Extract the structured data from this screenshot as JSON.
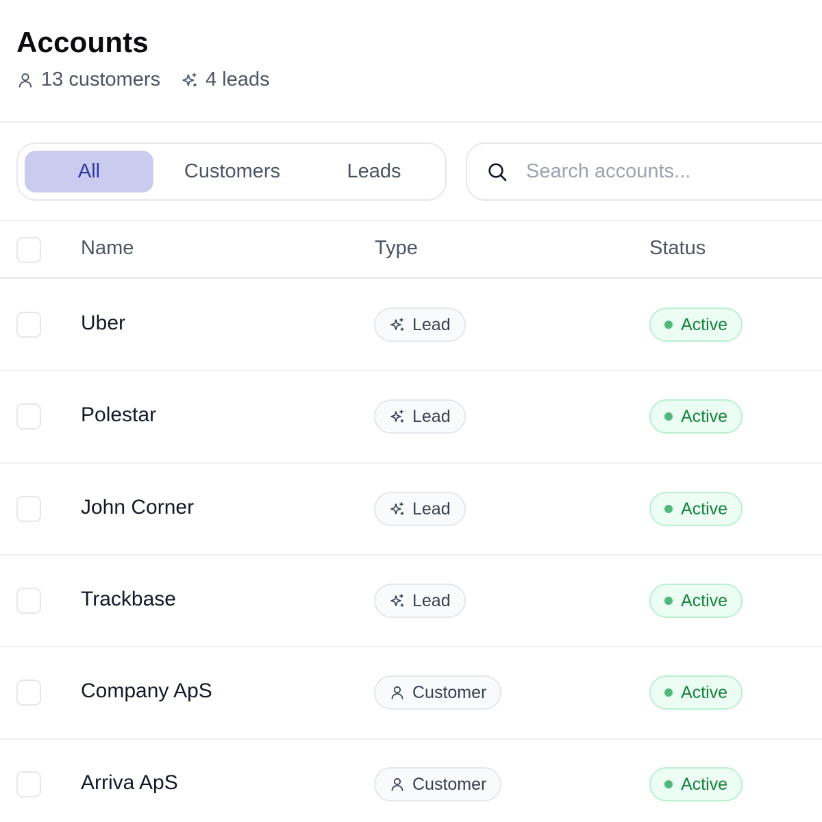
{
  "header": {
    "title": "Accounts",
    "customers_count": "13 customers",
    "leads_count": "4 leads"
  },
  "filters": {
    "tabs": [
      {
        "label": "All",
        "active": true
      },
      {
        "label": "Customers",
        "active": false
      },
      {
        "label": "Leads",
        "active": false
      }
    ]
  },
  "search": {
    "placeholder": "Search accounts..."
  },
  "table": {
    "columns": [
      "Name",
      "Type",
      "Status"
    ],
    "rows": [
      {
        "name": "Uber",
        "type": "Lead",
        "type_icon": "sparkle-icon",
        "status": "Active"
      },
      {
        "name": "Polestar",
        "type": "Lead",
        "type_icon": "sparkle-icon",
        "status": "Active"
      },
      {
        "name": "John Corner",
        "type": "Lead",
        "type_icon": "sparkle-icon",
        "status": "Active"
      },
      {
        "name": "Trackbase",
        "type": "Lead",
        "type_icon": "sparkle-icon",
        "status": "Active"
      },
      {
        "name": "Company ApS",
        "type": "Customer",
        "type_icon": "user-icon",
        "status": "Active"
      },
      {
        "name": "Arriva ApS",
        "type": "Customer",
        "type_icon": "user-icon",
        "status": "Active"
      }
    ]
  },
  "colors": {
    "tab_active_bg": "#c9cbef",
    "tab_active_text": "#2f3a9e",
    "status_bg": "#ecfdf3",
    "status_border": "#bbf0cf",
    "status_text": "#15803d",
    "status_dot": "#4fb87a"
  }
}
